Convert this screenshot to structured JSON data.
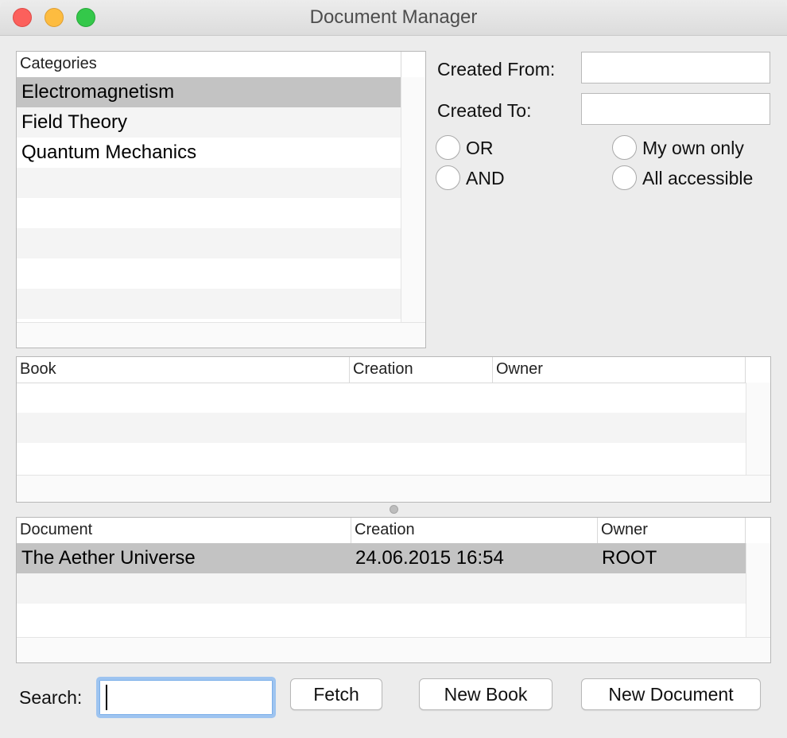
{
  "window": {
    "title": "Document Manager"
  },
  "categories": {
    "header": "Categories",
    "items": [
      "Electromagnetism",
      "Field Theory",
      "Quantum Mechanics"
    ],
    "selected_index": 0
  },
  "filters": {
    "created_from_label": "Created From:",
    "created_from_value": "",
    "created_to_label": "Created To:",
    "created_to_value": "",
    "radios": {
      "or_label": "OR",
      "and_label": "AND",
      "my_own_label": "My own only",
      "all_accessible_label": "All accessible"
    }
  },
  "books": {
    "columns": [
      "Book",
      "Creation",
      "Owner"
    ],
    "rows": []
  },
  "documents": {
    "columns": [
      "Document",
      "Creation",
      "Owner"
    ],
    "rows": [
      {
        "document": "The Aether Universe",
        "creation": "24.06.2015 16:54",
        "owner": "ROOT"
      }
    ],
    "selected_index": 0
  },
  "footer": {
    "search_label": "Search:",
    "search_value": "",
    "fetch_label": "Fetch",
    "new_book_label": "New Book",
    "new_document_label": "New Document"
  },
  "colors": {
    "selection": "#c3c3c3",
    "focus_ring": "#9ec4f0",
    "close": "#fc605c",
    "minimize": "#fdbc40",
    "zoom": "#34c84a"
  }
}
